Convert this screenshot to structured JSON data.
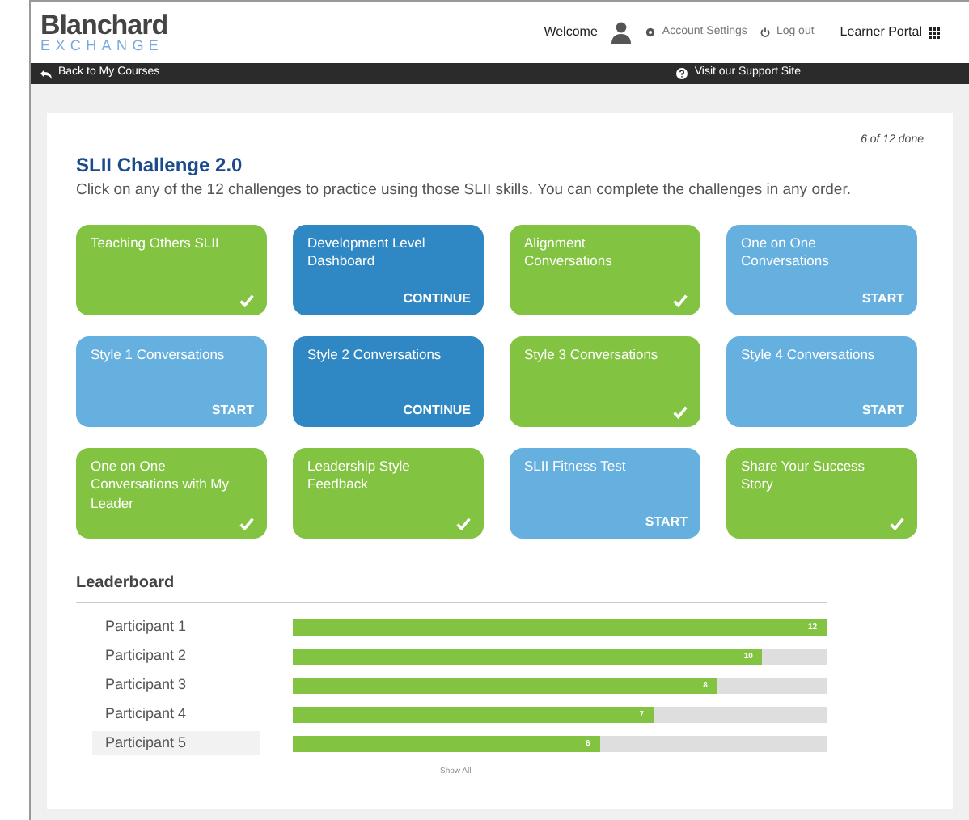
{
  "header": {
    "logo_top": "Blanchard",
    "logo_bottom": "EXCHANGE",
    "welcome": "Welcome",
    "account_settings": "Account Settings",
    "log_out": "Log out",
    "portal": "Learner Portal"
  },
  "nav_bar": {
    "back": "Back to My Courses",
    "support": "Visit our Support Site"
  },
  "progress": "6 of 12 done",
  "title": "SLII Challenge 2.0",
  "intro": "Click on any of the 12 challenges to practice using those SLII skills. You can complete the challenges in any order.",
  "challenges": [
    {
      "label": "Teaching Others SLII",
      "kind": "done"
    },
    {
      "label": "Development Level Dashboard",
      "kind": "continue",
      "action": "CONTINUE"
    },
    {
      "label": "Alignment Conversations",
      "kind": "done"
    },
    {
      "label": "One on One Conversations",
      "kind": "start",
      "action": "START"
    },
    {
      "label": "Style 1 Conversations",
      "kind": "start",
      "action": "START"
    },
    {
      "label": "Style 2 Conversations",
      "kind": "continue",
      "action": "CONTINUE"
    },
    {
      "label": "Style 3 Conversations",
      "kind": "done"
    },
    {
      "label": "Style 4 Conversations",
      "kind": "start",
      "action": "START"
    },
    {
      "label": "One on One Conversations with My Leader",
      "kind": "done"
    },
    {
      "label": "Leadership Style Feedback",
      "kind": "done"
    },
    {
      "label": "SLII Fitness Test",
      "kind": "start",
      "action": "START"
    },
    {
      "label": "Share Your Success Story",
      "kind": "done"
    }
  ],
  "leaderboard": {
    "title": "Leaderboard",
    "rows": [
      {
        "name": "Participant 1",
        "level": 1.0,
        "score": "12",
        "selected": false
      },
      {
        "name": "Participant 2",
        "level": 0.88,
        "score": "10",
        "selected": false
      },
      {
        "name": "Participant 3",
        "level": 0.795,
        "score": "8",
        "selected": false
      },
      {
        "name": "Participant 4",
        "level": 0.676,
        "score": "7",
        "selected": false
      },
      {
        "name": "Participant 5",
        "level": 0.575,
        "score": "6",
        "selected": true
      }
    ],
    "show_all": "Show All"
  }
}
